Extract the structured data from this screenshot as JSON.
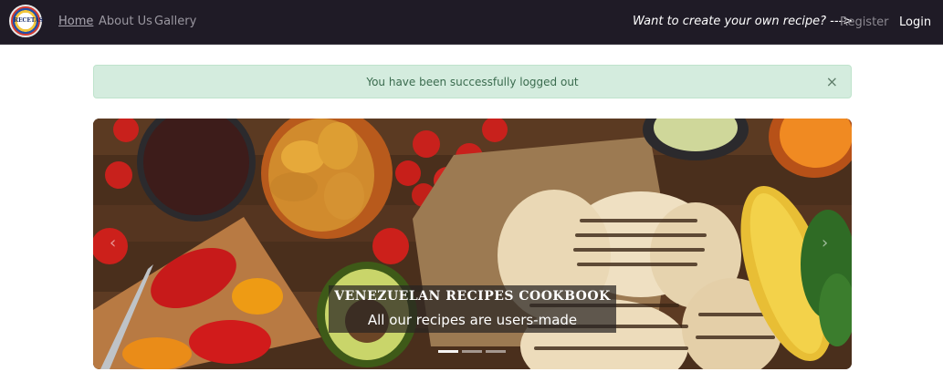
{
  "navbar": {
    "logo_text": "RECETAS",
    "links": [
      "Home",
      "About Us",
      "Gallery"
    ],
    "cta": "Want to create your own recipe? --->",
    "register": "Register",
    "login": "Login"
  },
  "alert": {
    "message": "You have been successfully logged out",
    "close": "×"
  },
  "carousel": {
    "title": "VENEZUELAN RECIPES COOKBOOK",
    "subtitle": "All our recipes are users-made",
    "prev": "‹",
    "next": "›",
    "active_slide": 1,
    "slide_count": 3
  },
  "colors": {
    "navbar_bg": "#1f1b26",
    "alert_bg": "#d4ecde",
    "alert_text": "#3a6b4e"
  }
}
